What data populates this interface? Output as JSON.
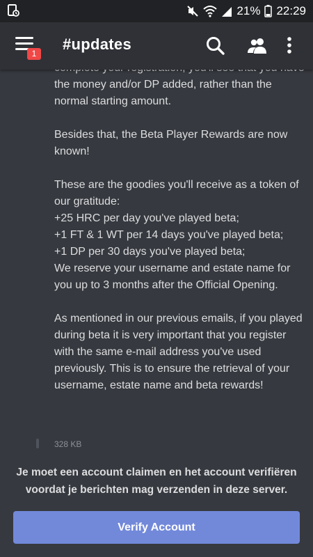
{
  "status_bar": {
    "battery": "21%",
    "time": "22:29",
    "icons": [
      "sim-icon",
      "mute-icon",
      "wifi-icon",
      "signal-icon",
      "battery-icon"
    ]
  },
  "app_bar": {
    "channel": "#updates",
    "menu_badge": "1",
    "icons": [
      "menu-icon",
      "search-icon",
      "members-icon",
      "more-vertical-icon"
    ]
  },
  "message": {
    "paragraphs": [
      "complete your registration, you'll see that you have the money and/or DP added, rather than the normal starting amount.",
      "Besides that, the Beta Player Rewards are now known!",
      "These are the goodies you'll receive as a token of our gratitude:\n+25 HRC per day you've played beta;\n+1 FT & 1 WT per 14 days you've played beta;\n+1 DP per 30 days you've played beta;\nWe reserve your username and estate name for you up to 3 months after the Official Opening.",
      "As mentioned in our previous emails, if you played during beta it is very important that you register with the same e-mail address you've used previously. This is to ensure the retrieval of your username, estate name and beta rewards!"
    ],
    "attachment_size": "328 KB"
  },
  "footer": {
    "notice": "Je moet een account claimen en het account verifiëren voordat je berichten mag verzenden in deze server.",
    "verify_label": "Verify Account"
  },
  "colors": {
    "background": "#36393f",
    "app_bar": "#2f3136",
    "status_bar": "#202225",
    "accent": "#7289da",
    "badge": "#f04747",
    "text": "#dcddde"
  }
}
